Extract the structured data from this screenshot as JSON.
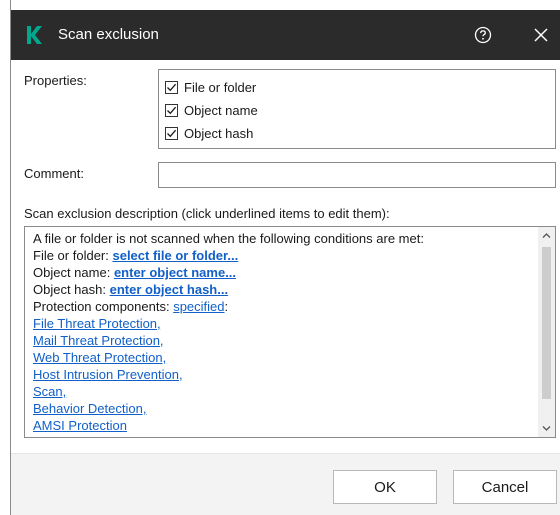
{
  "window": {
    "title": "Scan exclusion",
    "logo_letter": "K",
    "accent_color": "#00a88e",
    "titlebar_color": "#2b2b2b"
  },
  "properties": {
    "label": "Properties:",
    "items": [
      {
        "label": "File or folder",
        "checked": true
      },
      {
        "label": "Object name",
        "checked": true
      },
      {
        "label": "Object hash",
        "checked": true
      }
    ]
  },
  "comment": {
    "label": "Comment:",
    "value": "",
    "placeholder": ""
  },
  "description": {
    "heading": "Scan exclusion description (click underlined items to edit them):",
    "intro": "A file or folder is not scanned when the following conditions are met:",
    "file_label": "File or folder: ",
    "file_link": "select file or folder...",
    "name_label": "Object name: ",
    "name_link": "enter object name...",
    "hash_label": "Object hash: ",
    "hash_link": "enter object hash...",
    "components_label": "Protection components: ",
    "components_link": "specified",
    "components_suffix": ":",
    "components": [
      "File Threat Protection,",
      "Mail Threat Protection,",
      "Web Threat Protection,",
      "Host Intrusion Prevention,",
      "Scan,",
      "Behavior Detection,",
      "AMSI Protection"
    ],
    "link_color": "#1160c9"
  },
  "buttons": {
    "ok": "OK",
    "cancel": "Cancel"
  }
}
